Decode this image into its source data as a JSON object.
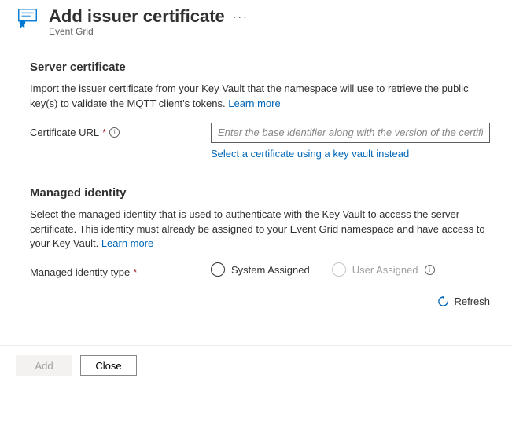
{
  "header": {
    "title": "Add issuer certificate",
    "subtitle": "Event Grid",
    "more": "···"
  },
  "serverCert": {
    "heading": "Server certificate",
    "desc": "Import the issuer certificate from your Key Vault that the namespace will use to retrieve the public key(s) to validate the MQTT client's tokens. ",
    "learnMore": "Learn more",
    "fieldLabel": "Certificate URL",
    "placeholder": "Enter the base identifier along with the version of the certificate",
    "selectLink": "Select a certificate using a key vault instead"
  },
  "managedIdentity": {
    "heading": "Managed identity",
    "desc": "Select the managed identity that is used to authenticate with the Key Vault to access the server certificate. This identity must already be assigned to your Event Grid namespace and have access to your Key Vault. ",
    "learnMore": "Learn more",
    "typeLabel": "Managed identity type",
    "opt1": "System Assigned",
    "opt2": "User Assigned",
    "refresh": "Refresh"
  },
  "footer": {
    "add": "Add",
    "close": "Close"
  }
}
